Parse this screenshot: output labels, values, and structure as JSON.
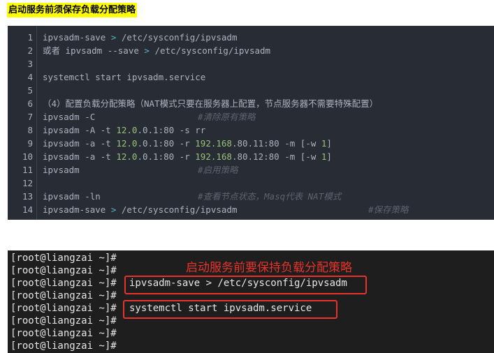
{
  "heading": "启动服务前须保存负载分配策略",
  "code_lines": [
    {
      "n": "1",
      "cmd": [
        "ipvsadm-save ",
        {
          "op": ">"
        },
        " /etc/sysconfig/ipvsadm"
      ],
      "comment": ""
    },
    {
      "n": "2",
      "cmd": [
        "或者 ipvsadm --save ",
        {
          "op": ">"
        },
        " /etc/sysconfig/ipvsadm"
      ],
      "comment": ""
    },
    {
      "n": "3",
      "cmd": [],
      "comment": ""
    },
    {
      "n": "4",
      "cmd": [
        "systemctl start ipvsadm.service"
      ],
      "comment": ""
    },
    {
      "n": "5",
      "cmd": [],
      "comment": ""
    },
    {
      "n": "6",
      "cmd": [
        "（4）配置负载分配策略（NAT模式只要在服务器上配置，节点服务器不需要特殊配置）"
      ],
      "comment": ""
    },
    {
      "n": "7",
      "cmd": [
        "ipvsadm -C"
      ],
      "comment": "#清除原有策略"
    },
    {
      "n": "8",
      "cmd": [
        "ipvsadm -A -t ",
        {
          "num": "12.0"
        },
        ".0.1:80 -s rr"
      ],
      "comment": ""
    },
    {
      "n": "9",
      "cmd": [
        "ipvsadm -a -t ",
        {
          "num": "12.0"
        },
        ".0.1:80 -r ",
        {
          "num": "192.168"
        },
        ".80.11:80 -m [-w ",
        {
          "num": "1"
        },
        "]"
      ],
      "comment": ""
    },
    {
      "n": "10",
      "cmd": [
        "ipvsadm -a -t ",
        {
          "num": "12.0"
        },
        ".0.1:80 -r ",
        {
          "num": "192.168"
        },
        ".80.12:80 -m [-w ",
        {
          "num": "1"
        },
        "]"
      ],
      "comment": ""
    },
    {
      "n": "11",
      "cmd": [
        "ipvsadm"
      ],
      "comment": "#启用策略"
    },
    {
      "n": "12",
      "cmd": [],
      "comment": ""
    },
    {
      "n": "13",
      "cmd": [
        "ipvsadm -ln"
      ],
      "comment": "#查看节点状态，Masq代表 NAT模式"
    },
    {
      "n": "14",
      "cmd": [
        "ipvsadm-save ",
        {
          "op": ">"
        },
        " /etc/sysconfig/ipvsadm"
      ],
      "comment": "#保存策略"
    }
  ],
  "terminal": {
    "prompt": "[root@liangzai ~]#",
    "annotation": "启动服务前要保持负载分配策略",
    "lines": [
      {
        "cmd": ""
      },
      {
        "cmd": ""
      },
      {
        "cmd": "ipvsadm-save > /etc/sysconfig/ipvsadm"
      },
      {
        "cmd": ""
      },
      {
        "cmd": "systemctl start ipvsadm.service"
      },
      {
        "cmd": ""
      },
      {
        "cmd": ""
      },
      {
        "cmd": ""
      }
    ]
  },
  "colors": {
    "heading_bg": "#ffff00",
    "code_bg": "#282c34",
    "terminal_bg": "#1e1e1e",
    "annotation": "#e8332c",
    "number": "#98c379",
    "operator": "#56b6c2",
    "comment": "#5c6370"
  }
}
